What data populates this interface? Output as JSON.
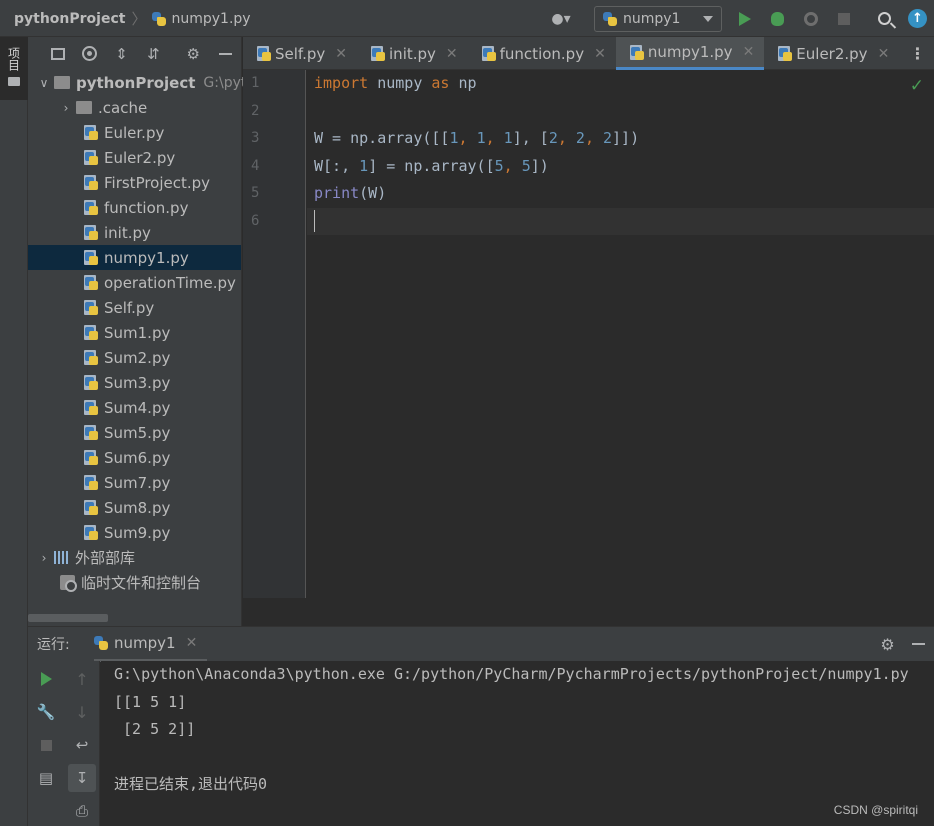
{
  "breadcrumb": {
    "project": "pythonProject",
    "file": "numpy1.py"
  },
  "run_config": {
    "name": "numpy1"
  },
  "toolbar_icons": [
    "user-icon",
    "run-icon",
    "debug-icon",
    "coverage-icon",
    "stop-icon",
    "search-icon",
    "update-icon"
  ],
  "side_strip": {
    "label": "项目"
  },
  "project_tree": {
    "root": {
      "name": "pythonProject",
      "path": "G:\\pyt"
    },
    "folder": ".cache",
    "files": [
      "Euler.py",
      "Euler2.py",
      "FirstProject.py",
      "function.py",
      "init.py",
      "numpy1.py",
      "operationTime.py",
      "Self.py",
      "Sum1.py",
      "Sum2.py",
      "Sum3.py",
      "Sum4.py",
      "Sum5.py",
      "Sum6.py",
      "Sum7.py",
      "Sum8.py",
      "Sum9.py"
    ],
    "selected": "numpy1.py",
    "external_libs": "外部部库",
    "scratches": "临时文件和控制台"
  },
  "tabs": [
    {
      "label": "Self.py",
      "active": false
    },
    {
      "label": "init.py",
      "active": false
    },
    {
      "label": "function.py",
      "active": false
    },
    {
      "label": "numpy1.py",
      "active": true
    },
    {
      "label": "Euler2.py",
      "active": false
    }
  ],
  "code": {
    "line_numbers": [
      "1",
      "2",
      "3",
      "4",
      "5",
      "6"
    ],
    "l1": {
      "kw1": "import",
      "mod": " numpy ",
      "kw2": "as",
      "alias": " np"
    },
    "l3": {
      "a": "W = np.array([[",
      "n1": "1",
      "c1": ", ",
      "n2": "1",
      "c2": ", ",
      "n3": "1",
      "c3": "], [",
      "n4": "2",
      "c4": ", ",
      "n5": "2",
      "c5": ", ",
      "n6": "2",
      "end": "]])"
    },
    "l4": {
      "a": "W[:, ",
      "n1": "1",
      "b": "] = np.array([",
      "n2": "5",
      "c": ", ",
      "n3": "5",
      "end": "])"
    },
    "l5": {
      "fn": "print",
      "rest": "(W)"
    }
  },
  "run_panel": {
    "label": "运行:",
    "tab": "numpy1",
    "output": [
      "G:\\python\\Anaconda3\\python.exe G:/python/PyCharm/PycharmProjects/pythonProject/numpy1.py",
      "[[1 5 1]",
      " [2 5 2]]",
      "",
      "进程已结束,退出代码0"
    ]
  },
  "watermark": "CSDN @spiritqi",
  "colors": {
    "keyword": "#cc7832",
    "number": "#6897bb",
    "builtin": "#8888c6",
    "accent": "#4a88c7",
    "run_green": "#499c54"
  }
}
